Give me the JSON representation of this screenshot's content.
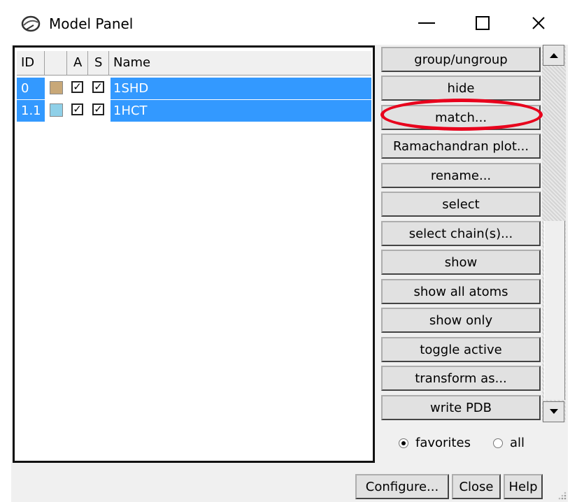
{
  "window": {
    "title": "Model Panel",
    "minimize_glyph": "—",
    "maximize_glyph": "☐",
    "close_glyph": "✕"
  },
  "table": {
    "columns": [
      "ID",
      "",
      "A",
      "S",
      "Name"
    ],
    "rows": [
      {
        "id": "0",
        "swatch_color": "#c8a878",
        "active": "✓",
        "shown": "✓",
        "name": "1SHD"
      },
      {
        "id": "1.1",
        "swatch_color": "#8fd0e8",
        "active": "✓",
        "shown": "✓",
        "name": "1HCT"
      }
    ]
  },
  "actions": [
    "group/ungroup",
    "hide",
    "match...",
    "Ramachandran plot...",
    "rename...",
    "select",
    "select chain(s)...",
    "show",
    "show all atoms",
    "show only",
    "toggle active",
    "transform as...",
    "write PDB"
  ],
  "highlighted_action": "match...",
  "filter": {
    "favorites_label": "favorites",
    "all_label": "all",
    "selected": "favorites"
  },
  "footer": {
    "configure_label": "Configure...",
    "close_label": "Close",
    "help_label": "Help"
  },
  "colors": {
    "selection": "#3399ff",
    "annotation": "#e8001c"
  }
}
